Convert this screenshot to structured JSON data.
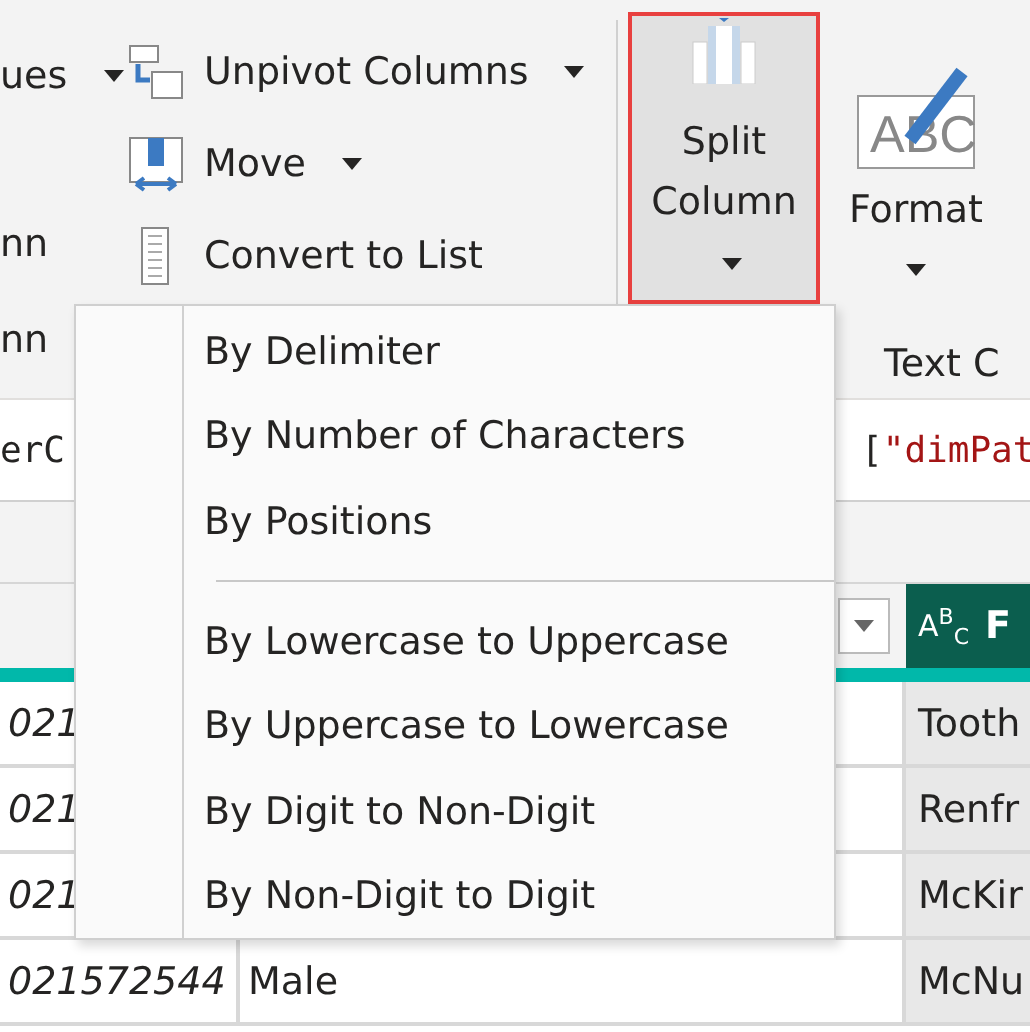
{
  "ribbon": {
    "left_group": {
      "button_1": "ues",
      "button_1_has_menu": true,
      "button_2": "nn",
      "label": "nn"
    },
    "commands": [
      {
        "label": "Unpivot Columns",
        "has_menu": true
      },
      {
        "label": "Move",
        "has_menu": true
      },
      {
        "label": "Convert to List",
        "has_menu": false
      }
    ],
    "split_column": {
      "label": "Split Column",
      "selected": true,
      "has_menu": true
    },
    "format": {
      "label": "Format",
      "has_menu": true,
      "icon_text": "ABC"
    },
    "text_group_label": "Text C"
  },
  "formula_bar": {
    "left_text": "erC",
    "bracket": "[",
    "string": "\"dimPat"
  },
  "split_menu": [
    {
      "kind": "item",
      "label": "By Delimiter"
    },
    {
      "kind": "item",
      "label": "By Number of Characters"
    },
    {
      "kind": "item",
      "label": "By Positions"
    },
    {
      "kind": "separator"
    },
    {
      "kind": "item",
      "label": "By Lowercase to Uppercase"
    },
    {
      "kind": "item",
      "label": "By Uppercase to Lowercase"
    },
    {
      "kind": "item",
      "label": "By Digit to Non-Digit"
    },
    {
      "kind": "item",
      "label": "By Non-Digit to Digit"
    }
  ],
  "table": {
    "column_3_type": "A$^{B}$$_{C}$",
    "column_3_header": "F",
    "rows": [
      {
        "column_1": "021",
        "column_3": "Tooth"
      },
      {
        "column_1": "021",
        "column_3": "Renfr"
      },
      {
        "column_1": "021",
        "column_3": "McKir"
      },
      {
        "column_1": "021572544",
        "column_2": "Male",
        "column_3": "McNu"
      }
    ]
  }
}
